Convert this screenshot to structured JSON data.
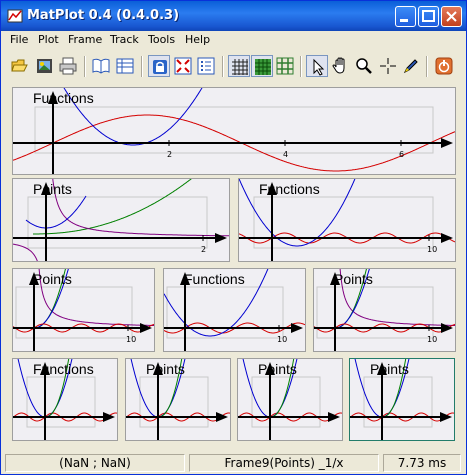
{
  "window": {
    "title": "MatPlot 0.4 (0.4.0.3)"
  },
  "menu": [
    "File",
    "Plot",
    "Frame",
    "Track",
    "Tools",
    "Help"
  ],
  "toolbar": {
    "icons": [
      "open-folder-icon",
      "save-image-icon",
      "print-icon",
      "book-icon",
      "table-icon",
      "lock-icon",
      "zoom-fit-icon",
      "list-icon",
      "grid-fine-icon",
      "grid-green-icon",
      "grid-coarse-icon",
      "pointer-icon",
      "hand-pan-icon",
      "magnifier-icon",
      "crosshair-icon",
      "pen-icon",
      "power-icon"
    ]
  },
  "frames": [
    {
      "title": "Functions",
      "ticks": [
        "2",
        "4",
        "6"
      ]
    },
    {
      "title": "Points",
      "ticks": [
        "2"
      ]
    },
    {
      "title": "Functions",
      "ticks": [
        "10"
      ]
    },
    {
      "title": "Points",
      "ticks": [
        "10"
      ]
    },
    {
      "title": "Functions",
      "ticks": [
        "10"
      ]
    },
    {
      "title": "Points",
      "ticks": [
        "10"
      ]
    },
    {
      "title": "Functions",
      "ticks": []
    },
    {
      "title": "Points",
      "ticks": []
    },
    {
      "title": "Points",
      "ticks": []
    },
    {
      "title": "Points",
      "ticks": []
    }
  ],
  "status": {
    "coords": "(NaN ; NaN)",
    "frame_info": "Frame9(Points) _1/x",
    "timing": "7.73 ms"
  },
  "colors": {
    "title_bar": "#1856d0",
    "frame_bg": "#f0eff3",
    "selected_border": "#227c6a",
    "curve_red": "#d40000",
    "curve_blue": "#0000d0",
    "curve_green": "#008000",
    "curve_purple": "#800080",
    "axis": "#000000"
  }
}
